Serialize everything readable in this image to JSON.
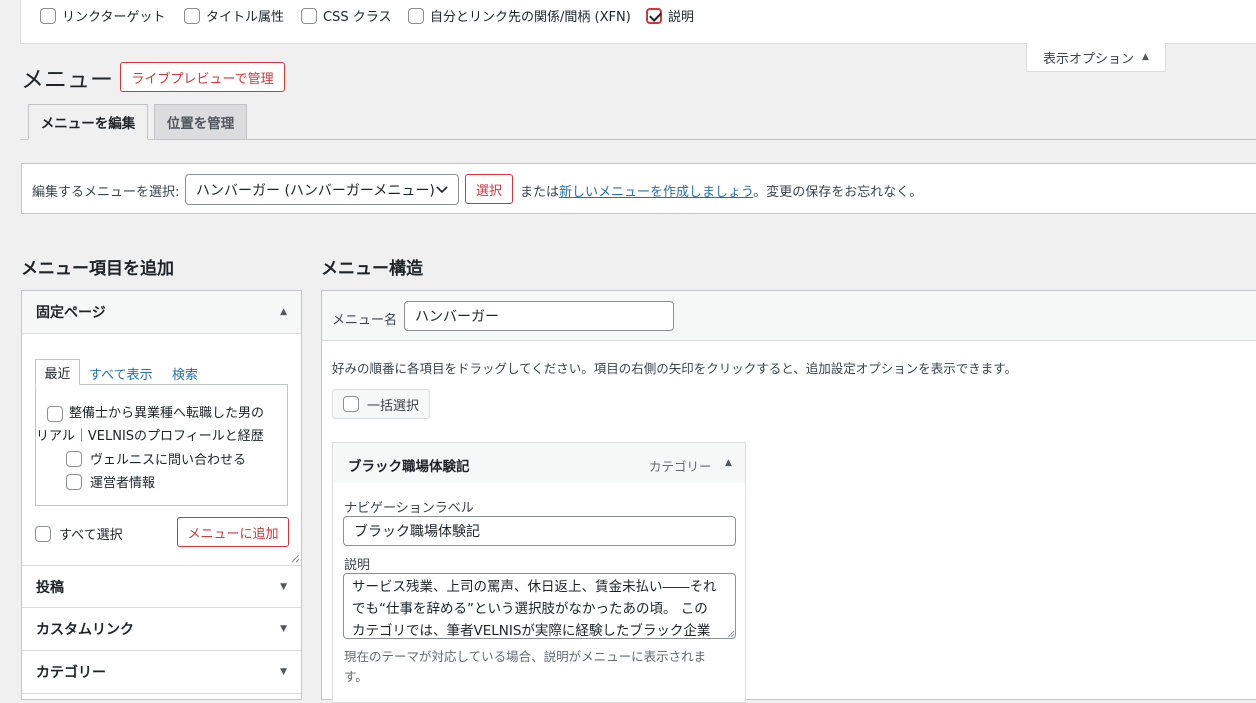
{
  "screen_options": {
    "items": [
      {
        "label": "リンクターゲット",
        "checked": false
      },
      {
        "label": "タイトル属性",
        "checked": false
      },
      {
        "label": "CSS クラス",
        "checked": false
      },
      {
        "label": "自分とリンク先の関係/間柄 (XFN)",
        "checked": false
      },
      {
        "label": "説明",
        "checked": true
      }
    ],
    "toggle_label": "表示オプション"
  },
  "header": {
    "title": "メニュー",
    "live_preview_label": "ライブプレビューで管理"
  },
  "tabs": [
    {
      "label": "メニューを編集",
      "active": true
    },
    {
      "label": "位置を管理",
      "active": false
    }
  ],
  "select_bar": {
    "prompt": "編集するメニューを選択:",
    "selected_menu": "ハンバーガー (ハンバーガーメニュー)",
    "select_button": "選択",
    "or_text": "または",
    "create_link": "新しいメニューを作成しましょう",
    "save_note": "。変更の保存をお忘れなく。"
  },
  "add_items": {
    "heading": "メニュー項目を追加",
    "pages_panel": {
      "title": "固定ページ",
      "inner_tabs": [
        "最近",
        "すべて表示",
        "検索"
      ],
      "items": [
        {
          "label_line1": "整備士から異業種へ転職した男の",
          "label_line2": "リアル｜VELNISのプロフィールと経歴"
        },
        {
          "label": "ヴェルニスに問い合わせる"
        },
        {
          "label": "運営者情報"
        }
      ],
      "select_all": "すべて選択",
      "add_button": "メニューに追加"
    },
    "sections": [
      "投稿",
      "カスタムリンク",
      "カテゴリー"
    ]
  },
  "structure": {
    "heading": "メニュー構造",
    "name_label": "メニュー名",
    "name_value": "ハンバーガー",
    "instructions": "好みの順番に各項目をドラッグしてください。項目の右側の矢印をクリックすると、追加設定オプションを表示できます。",
    "bulk_select": "一括選択",
    "item": {
      "title": "ブラック職場体験記",
      "type": "カテゴリー",
      "nav_label_caption": "ナビゲーションラベル",
      "nav_label_value": "ブラック職場体験記",
      "desc_caption": "説明",
      "desc_line1": "サービス残業、上司の罵声、休日返上、賃金未払い――それ",
      "desc_line2": "でも“仕事を辞める”という選択肢がなかったあの頃。 この",
      "desc_line3": "カテゴリでは、筆者VELNISが実際に経験したブラック企業",
      "desc_help_line1": "現在のテーマが対応している場合、説明がメニューに表示されま",
      "desc_help_line2": "す。"
    }
  }
}
